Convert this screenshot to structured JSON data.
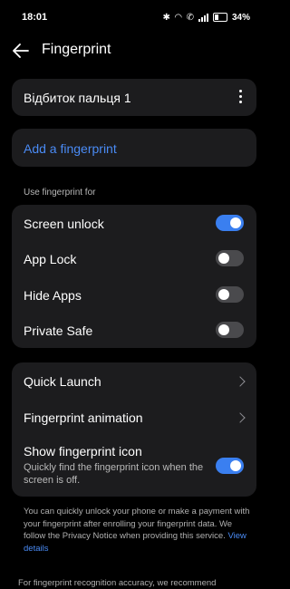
{
  "status_bar": {
    "time": "18:01",
    "battery": "34%"
  },
  "header": {
    "title": "Fingerprint"
  },
  "fingerprint": {
    "name": "Відбиток пальця 1"
  },
  "add_fingerprint": {
    "label": "Add a fingerprint"
  },
  "section": {
    "label": "Use fingerprint for"
  },
  "use_for": [
    {
      "label": "Screen unlock",
      "enabled": true
    },
    {
      "label": "App Lock",
      "enabled": false
    },
    {
      "label": "Hide Apps",
      "enabled": false
    },
    {
      "label": "Private Safe",
      "enabled": false
    }
  ],
  "more_settings": {
    "quick_launch": "Quick Launch",
    "fingerprint_animation": "Fingerprint animation",
    "show_icon": {
      "label": "Show fingerprint icon",
      "subtitle": "Quickly find the fingerprint icon when the screen is off.",
      "enabled": true
    }
  },
  "info": {
    "text": "You can quickly unlock your phone or make a payment with your fingerprint after enrolling your fingerprint data. We follow the Privacy Notice when providing this service.",
    "link": "View details"
  },
  "footer": {
    "text": "For fingerprint recognition accuracy, we recommend"
  },
  "colors": {
    "accent": "#4a8bf5",
    "toggle_on": "#3a7ff0",
    "card": "#1c1c1e"
  }
}
